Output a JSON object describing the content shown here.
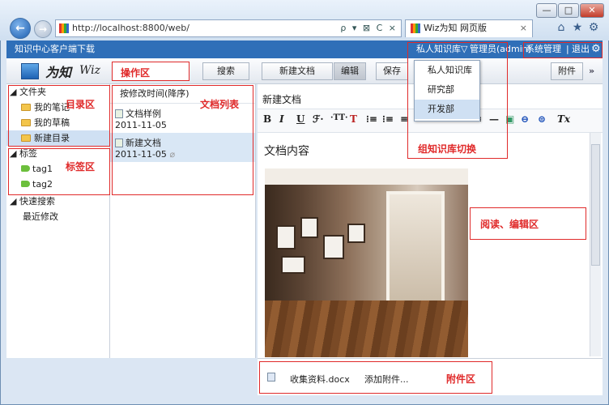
{
  "browser": {
    "url": "http://localhost:8800/web/",
    "tab_title": "Wiz为知 网页版",
    "tab_close": "×",
    "addr_tools": "ρ ▾ ⊠ C ×"
  },
  "appbar": {
    "download_link": "知识中心客户端下载",
    "kb_switch": "私人知识库▽",
    "user": "管理员(admin)",
    "admin_link": "系统管理",
    "separator": "|",
    "logout": "退出"
  },
  "toolbar": {
    "logo_cn": "为知",
    "logo_en": "Wiz",
    "op_area_label": "操作区",
    "search_label": "搜索",
    "new_doc_label": "新建文档",
    "edit_label": "编辑",
    "save_label": "保存",
    "attachment_label": "附件",
    "more_label": "»"
  },
  "dropdown": {
    "items": [
      "私人知识库",
      "研究部",
      "开发部"
    ],
    "selected": 2
  },
  "tree": {
    "folders_header": "文件夹",
    "folders": [
      "我的笔记",
      "我的草稿",
      "新建目录"
    ],
    "selected_folder": 2,
    "tags_header": "标签",
    "tags": [
      "tag1",
      "tag2"
    ],
    "quick_header": "快速搜索",
    "quick_items": [
      "最近修改"
    ]
  },
  "doclist": {
    "sort_label": "按修改时间(降序)",
    "docs": [
      {
        "title": "文档样例",
        "date": "2011-11-05"
      },
      {
        "title": "新建文档",
        "date": "2011-11-05"
      }
    ],
    "selected": 1
  },
  "editor": {
    "doc_title": "新建文档",
    "content_heading": "文档内容",
    "format_buttons": [
      "B",
      "I",
      "U",
      "ℱ·",
      "·TT·",
      "T",
      "⁝≡",
      "⁝≡",
      "≡",
      "≡",
      "≡",
      "≡",
      "—",
      "▣",
      "⊖",
      "⊜",
      "Tx"
    ]
  },
  "attachments": {
    "file_name": "收集资料.docx",
    "add_label": "添加附件..."
  },
  "annotations": {
    "tree": "目录区",
    "tags": "标签区",
    "doclist": "文档列表",
    "kb_switch": "组知识库切换",
    "reading": "阅读、编辑区",
    "attach": "附件区"
  },
  "colors": {
    "appbar": "#2f6fb8",
    "annotation": "#e02a2a"
  },
  "window_controls": {
    "min": "—",
    "max": "□",
    "close": "✕"
  }
}
